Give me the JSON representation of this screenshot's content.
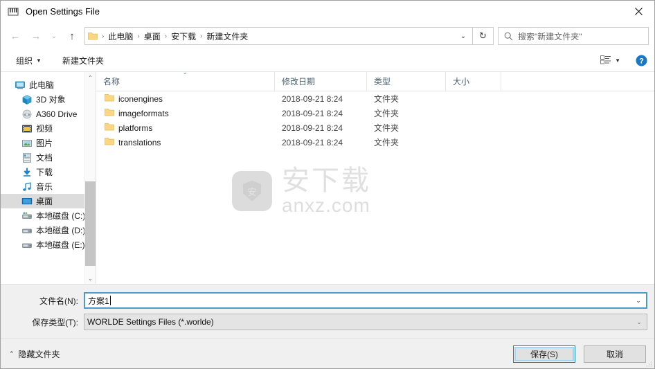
{
  "window": {
    "title": "Open Settings File",
    "app_icon": "piano-keyboard-icon",
    "close_label": "✕"
  },
  "nav": {
    "back_label": "←",
    "forward_label": "→",
    "recent_label": "⌄",
    "up_label": "↑",
    "refresh_label": "↻",
    "address_dropdown_label": "⌄",
    "breadcrumbs": [
      {
        "label": "此电脑"
      },
      {
        "label": "桌面"
      },
      {
        "label": "安下载"
      },
      {
        "label": "新建文件夹"
      }
    ],
    "separator": "›"
  },
  "search": {
    "placeholder": "搜索\"新建文件夹\"",
    "icon": "search-icon"
  },
  "toolbar": {
    "organize_label": "组织",
    "organize_caret": "▼",
    "new_folder_label": "新建文件夹",
    "view_caret": "▼",
    "help_label": "?"
  },
  "sidebar": {
    "items": [
      {
        "label": "此电脑",
        "icon": "this-pc-icon",
        "indent": false,
        "selected": false
      },
      {
        "label": "3D 对象",
        "icon": "3d-objects-icon",
        "indent": true,
        "selected": false
      },
      {
        "label": "A360 Drive",
        "icon": "a360-drive-icon",
        "indent": true,
        "selected": false
      },
      {
        "label": "视频",
        "icon": "videos-icon",
        "indent": true,
        "selected": false
      },
      {
        "label": "图片",
        "icon": "pictures-icon",
        "indent": true,
        "selected": false
      },
      {
        "label": "文档",
        "icon": "documents-icon",
        "indent": true,
        "selected": false
      },
      {
        "label": "下载",
        "icon": "downloads-icon",
        "indent": true,
        "selected": false
      },
      {
        "label": "音乐",
        "icon": "music-icon",
        "indent": true,
        "selected": false
      },
      {
        "label": "桌面",
        "icon": "desktop-icon",
        "indent": true,
        "selected": true
      },
      {
        "label": "本地磁盘 (C:)",
        "icon": "system-drive-icon",
        "indent": true,
        "selected": false
      },
      {
        "label": "本地磁盘 (D:)",
        "icon": "drive-icon",
        "indent": true,
        "selected": false
      },
      {
        "label": "本地磁盘 (E:)",
        "icon": "drive-icon",
        "indent": true,
        "selected": false
      }
    ],
    "scroll_up": "⌃",
    "scroll_down": "⌄"
  },
  "filelist": {
    "columns": [
      {
        "label": "名称",
        "sorted": true,
        "sort_caret": "⌃"
      },
      {
        "label": "修改日期",
        "sorted": false
      },
      {
        "label": "类型",
        "sorted": false
      },
      {
        "label": "大小",
        "sorted": false
      }
    ],
    "rows": [
      {
        "name": "iconengines",
        "date": "2018-09-21 8:24",
        "type": "文件夹",
        "size": ""
      },
      {
        "name": "imageformats",
        "date": "2018-09-21 8:24",
        "type": "文件夹",
        "size": ""
      },
      {
        "name": "platforms",
        "date": "2018-09-21 8:24",
        "type": "文件夹",
        "size": ""
      },
      {
        "name": "translations",
        "date": "2018-09-21 8:24",
        "type": "文件夹",
        "size": ""
      }
    ]
  },
  "watermark": {
    "badge_glyph": "安",
    "cn_text": "安下载",
    "en_text": "anxz.com"
  },
  "form": {
    "filename_label": "文件名(N):",
    "filename_value": "方案1",
    "filetype_label": "保存类型(T):",
    "filetype_value": "WORLDE Settings Files (*.worlde)",
    "dropdown_glyph": "⌄"
  },
  "footer": {
    "hide_folders_label": "隐藏文件夹",
    "hide_folders_caret": "⌃",
    "save_label": "保存(S)",
    "cancel_label": "取消"
  },
  "colors": {
    "accent": "#0078d7",
    "selection": "#dcdcdc",
    "folder": "#fbd784",
    "header_text": "#4a6070"
  }
}
